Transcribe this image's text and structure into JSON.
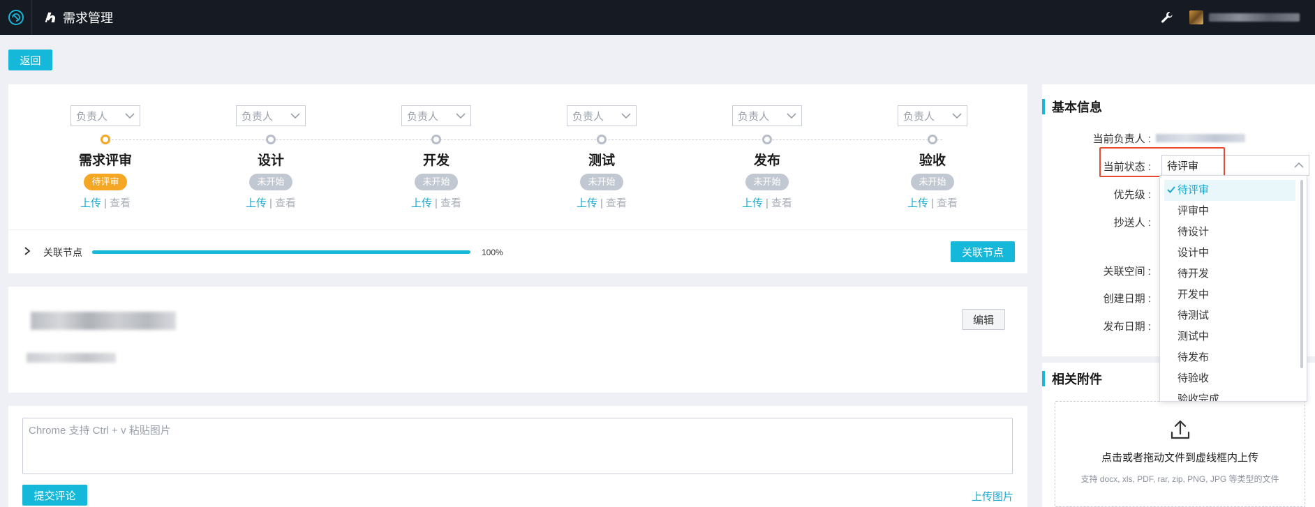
{
  "header": {
    "app_title": "需求管理",
    "icons": [
      "app-logo-icon",
      "title-brand-icon",
      "wrench-icon",
      "user-avatar"
    ]
  },
  "back_button": "返回",
  "stages": [
    {
      "owner_placeholder": "负责人",
      "name": "需求评审",
      "status": "待评审",
      "active": true,
      "upload": "上传",
      "sep": "|",
      "view": "查看"
    },
    {
      "owner_placeholder": "负责人",
      "name": "设计",
      "status": "未开始",
      "active": false,
      "upload": "上传",
      "sep": "|",
      "view": "查看"
    },
    {
      "owner_placeholder": "负责人",
      "name": "开发",
      "status": "未开始",
      "active": false,
      "upload": "上传",
      "sep": "|",
      "view": "查看"
    },
    {
      "owner_placeholder": "负责人",
      "name": "测试",
      "status": "未开始",
      "active": false,
      "upload": "上传",
      "sep": "|",
      "view": "查看"
    },
    {
      "owner_placeholder": "负责人",
      "name": "发布",
      "status": "未开始",
      "active": false,
      "upload": "上传",
      "sep": "|",
      "view": "查看"
    },
    {
      "owner_placeholder": "负责人",
      "name": "验收",
      "status": "未开始",
      "active": false,
      "upload": "上传",
      "sep": "|",
      "view": "查看"
    }
  ],
  "link_nodes": {
    "label": "关联节点",
    "progress_percent": 100,
    "progress_text": "100%",
    "button": "关联节点"
  },
  "description": {
    "edit_button": "编辑"
  },
  "comment": {
    "placeholder": "Chrome 支持 Ctrl + v 粘贴图片",
    "submit_button": "提交评论",
    "upload_image_link": "上传图片"
  },
  "basic_info": {
    "title": "基本信息",
    "current_owner_label": "当前负责人 :",
    "current_status_label": "当前状态 :",
    "current_status_value": "待评审",
    "priority_label": "优先级 :",
    "cc_label": "抄送人 :",
    "space_label": "关联空间 :",
    "created_label": "创建日期 :",
    "release_label": "发布日期 :"
  },
  "status_dropdown": {
    "options": [
      "待评审",
      "评审中",
      "待设计",
      "设计中",
      "待开发",
      "开发中",
      "待测试",
      "测试中",
      "待发布",
      "待验收",
      "验收完成"
    ],
    "selected": "待评审"
  },
  "attachments": {
    "title": "相关附件",
    "drop_text": "点击或者拖动文件到虚线框内上传",
    "hint": "支持 docx, xls, PDF, rar, zip, PNG, JPG 等类型的文件"
  },
  "colors": {
    "accent": "#16b8d9",
    "active_stage": "#f5a623",
    "highlight": "#e8492f",
    "topbar": "#161a23"
  }
}
